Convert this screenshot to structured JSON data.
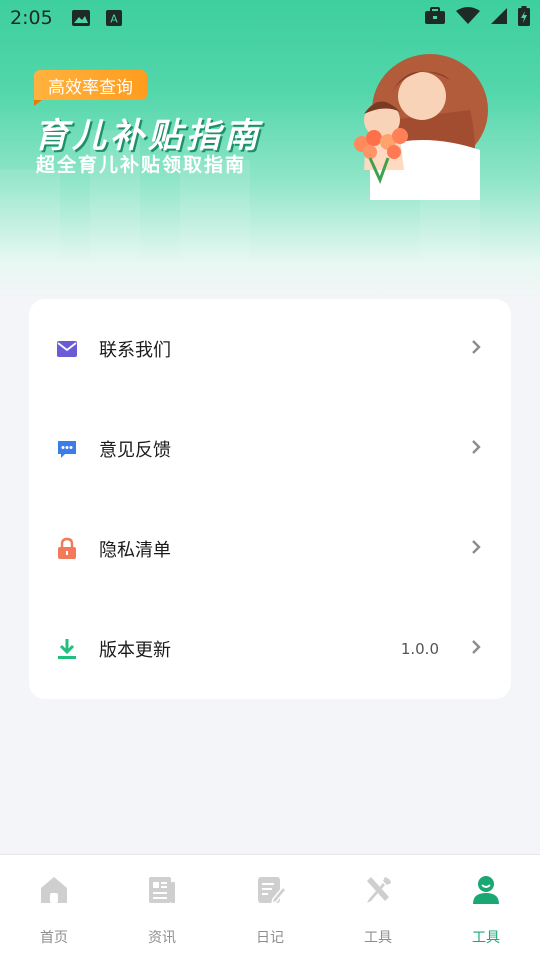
{
  "status_bar": {
    "time": "2:05",
    "icons": [
      "image-icon",
      "a-text-icon",
      "briefcase-icon",
      "wifi-icon",
      "signal-icon",
      "battery-charging-icon"
    ]
  },
  "banner": {
    "tag": "高效率查询",
    "title": "育儿补贴指南",
    "subtitle": "超全育儿补贴领取指南"
  },
  "menu": {
    "items": [
      {
        "label": "联系我们",
        "icon": "mail-icon",
        "color": "#6a5bd6"
      },
      {
        "label": "意见反馈",
        "icon": "chat-icon",
        "color": "#3d7be8"
      },
      {
        "label": "隐私清单",
        "icon": "lock-icon",
        "color": "#f27a5a"
      },
      {
        "label": "版本更新",
        "icon": "download-icon",
        "color": "#1fbf7e",
        "value": "1.0.0"
      }
    ]
  },
  "tabbar": {
    "items": [
      {
        "label": "首页",
        "icon": "home-icon",
        "active": false
      },
      {
        "label": "资讯",
        "icon": "news-icon",
        "active": false
      },
      {
        "label": "日记",
        "icon": "diary-icon",
        "active": false
      },
      {
        "label": "工具",
        "icon": "tools-icon",
        "active": false
      },
      {
        "label": "工具",
        "icon": "user-icon",
        "active": true
      }
    ],
    "active_color": "#1aa872",
    "inactive_color": "#cfcfcf"
  }
}
